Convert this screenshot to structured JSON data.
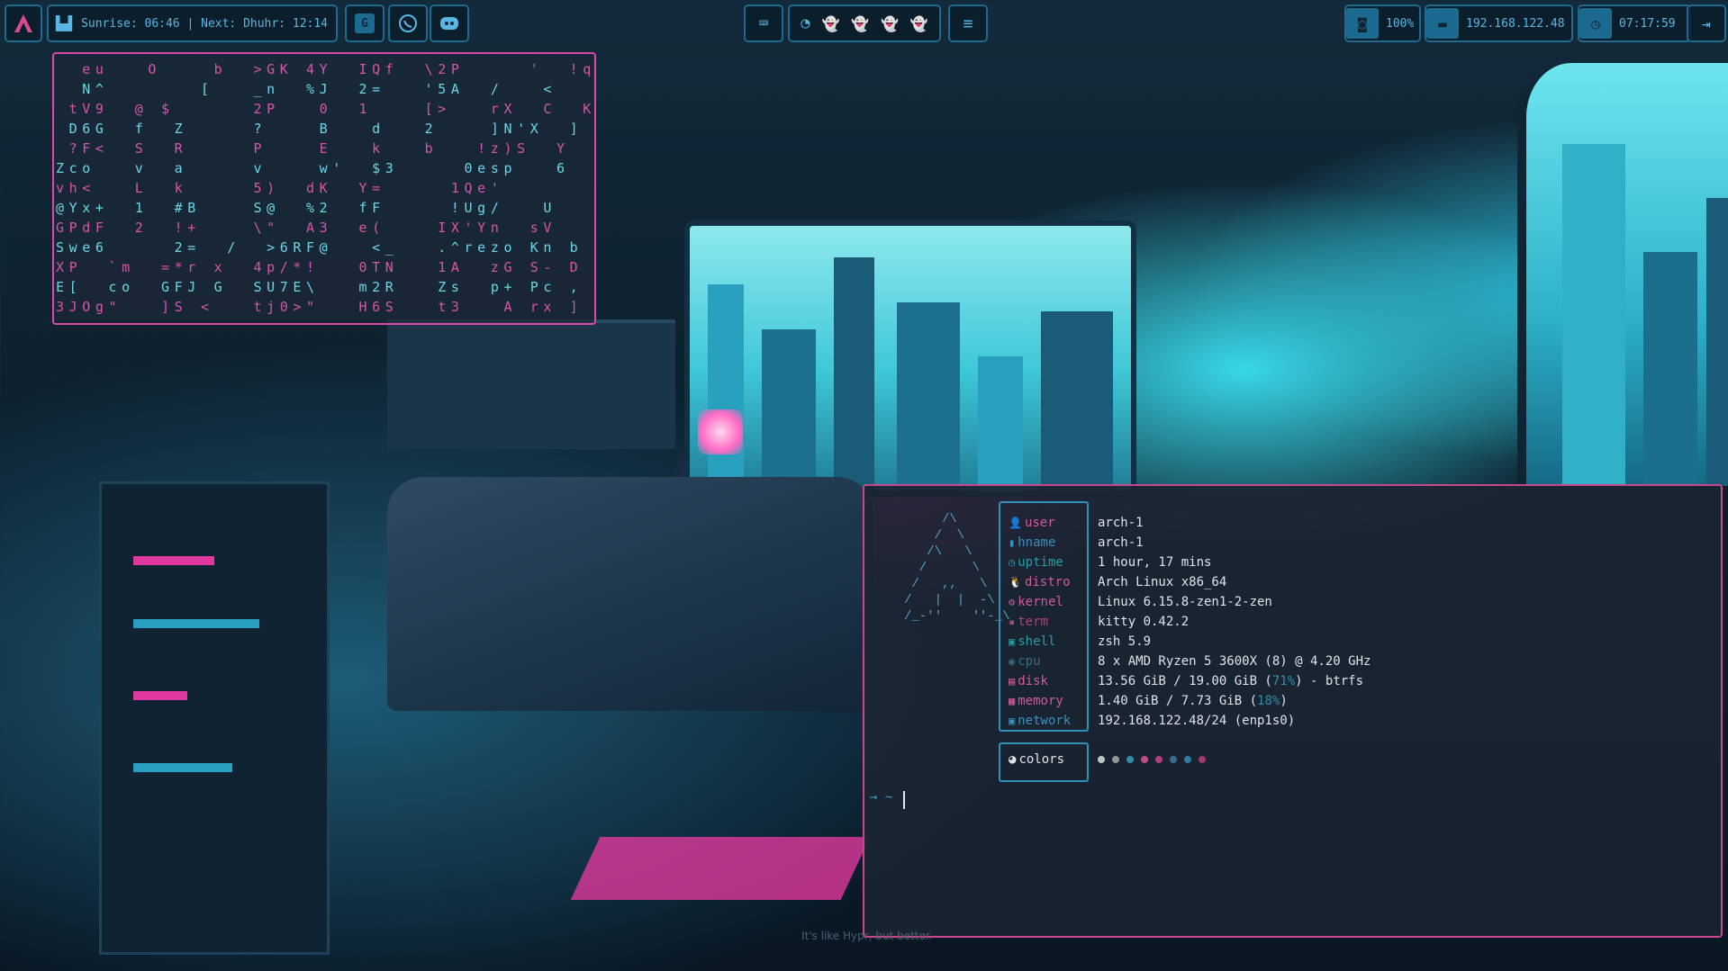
{
  "topbar": {
    "prayer_text": "Sunrise: 06:46 | Next: Dhuhr: 12:14",
    "volume": "100%",
    "ip": "192.168.122.48",
    "clock": "07:17:59"
  },
  "matrix": {
    "lines": [
      "  eu   O    b  >GK 4Y  IQf  \\2P     '  !q",
      "  N^       [   _n  %J  2=   '5A  /   <  ",
      " tV9  @ $      2P   0  1    [>   rX  C  K",
      " D6G  f  Z     ?    B   d   2    ]N'X  ]",
      " ?F<  S  R     P    E   k   b   !z)S  Y",
      "Zco   v  a     v    w'  $3     0esp   6",
      "vh<   L  k     5)  dK  Y=     1Qe'     ",
      "@Yx+  1  #B    S@  %2  fF     !Ug/   U",
      "GPdF  2  !+    \\\"  A3  e(    IX'Yn  sV",
      "Swe6     2=  /  >6RF@   <_   .^rezo Kn b",
      "XP  `m  =*r x  4p/*!   0TN   1A  zG S- D",
      "E[  co  GFJ G  SU7E\\   m2R   Zs  p+ Pc ,",
      "3JOg\"   ]S <   tj0>\"   H6S   t3   A rx ]"
    ]
  },
  "terminal": {
    "ascii": "     /\\\n    /  \\\n   /\\   \\\n  /      \\\n /   ,,   \\\n/   |  |  -\\\n/_-''    ''-_\\",
    "rows": [
      {
        "icon": "user-icon",
        "glyph": "👤",
        "label": "user",
        "value": "arch-1",
        "color": "#d15a9f"
      },
      {
        "icon": "hostname-icon",
        "glyph": "▮",
        "label": "hname",
        "value": "arch-1",
        "color": "#3c8fbe"
      },
      {
        "icon": "uptime-icon",
        "glyph": "◷",
        "label": "uptime",
        "value": "1 hour, 17 mins",
        "color": "#2a9aa6"
      },
      {
        "icon": "distro-icon",
        "glyph": "🐧",
        "label": "distro",
        "value": "Arch Linux x86_64",
        "color": "#d15a9f"
      },
      {
        "icon": "kernel-icon",
        "glyph": "⚙",
        "label": "kernel",
        "value": "Linux 6.15.8-zen1-2-zen",
        "color": "#d15a9f"
      },
      {
        "icon": "terminal-icon",
        "glyph": "▪",
        "label": "term",
        "value": "kitty 0.42.2",
        "color": "#a9457a"
      },
      {
        "icon": "shell-icon",
        "glyph": "▣",
        "label": "shell",
        "value": "zsh 5.9",
        "color": "#2a9aa6"
      },
      {
        "icon": "cpu-icon",
        "glyph": "◉",
        "label": "cpu",
        "value": "8 x AMD Ryzen 5 3600X (8) @ 4.20 GHz",
        "color": "#3b6b86"
      },
      {
        "icon": "disk-icon",
        "glyph": "▤",
        "label": "disk",
        "value_pre": "13.56 GiB / 19.00 GiB (",
        "value_pct": "71%",
        "value_post": ") - btrfs",
        "color": "#d15a9f"
      },
      {
        "icon": "memory-icon",
        "glyph": "▦",
        "label": "memory",
        "value_pre": "1.40 GiB / 7.73 GiB (",
        "value_pct": "18%",
        "value_post": ")",
        "color": "#d15a9f"
      },
      {
        "icon": "network-icon",
        "glyph": "▣",
        "label": "network",
        "value": "192.168.122.48/24 (enp1s0)",
        "color": "#3c8fbe"
      }
    ],
    "colors_label": "colors",
    "palette": [
      "#bfc3c8",
      "#8f969c",
      "#2f8fa8",
      "#c24b8e",
      "#b13d7d",
      "#3b6b86",
      "#2f7da5",
      "#9c3c74"
    ],
    "prompt_symbol": "→  ~"
  },
  "tagline": "It's like Hypr, but better."
}
